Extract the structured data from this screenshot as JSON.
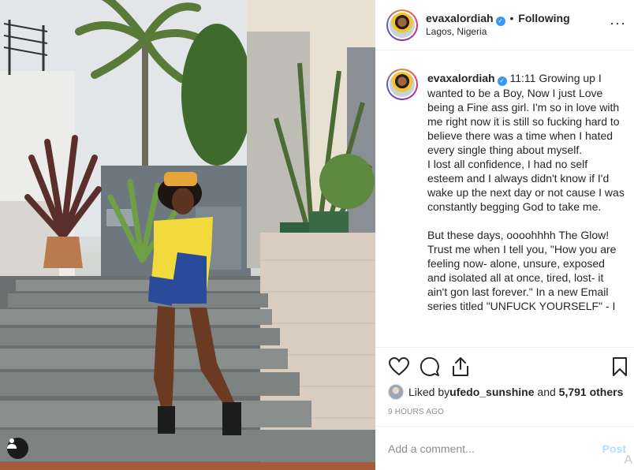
{
  "post": {
    "username": "evaxalordiah",
    "verified_mark": "✓",
    "separator": "•",
    "follow_label": "Following",
    "location": "Lagos, Nigeria",
    "more_label": "···"
  },
  "caption": {
    "username": "evaxalordiah",
    "text": " 11:11 Growing up I wanted to be a Boy, Now I just Love being a Fine ass girl. I'm so in love with me right now it is still so fucking hard to believe there was a time when I hated every single thing about myself.\nI lost all confidence, I had no self esteem and I always didn't know if I'd wake up the next day or not cause I was constantly begging God to take me.\n\nBut these days, oooohhhh The Glow! Trust me when I tell you, \"How you are feeling now- alone, unsure, exposed and isolated all at once, tired, lost- it ain't gon last forever.\" In a new Email series titled \"UNFUCK YOURSELF\" - I"
  },
  "likes": {
    "prefix": "Liked by ",
    "liker": "ufedo_sunshine",
    "and": " and ",
    "others": "5,791 others"
  },
  "timestamp": "9 HOURS AGO",
  "comment": {
    "placeholder": "Add a comment...",
    "post_label": "Post",
    "corner_glyph": "A"
  },
  "icons": {
    "like": "heart-icon",
    "comment": "comment-bubble-icon",
    "share": "share-icon",
    "save": "bookmark-icon",
    "user_tag": "user-tag-icon"
  },
  "colors": {
    "verified": "#3897f0",
    "post_button": "#b2dffc",
    "meta_grey": "#8e8e8e"
  }
}
